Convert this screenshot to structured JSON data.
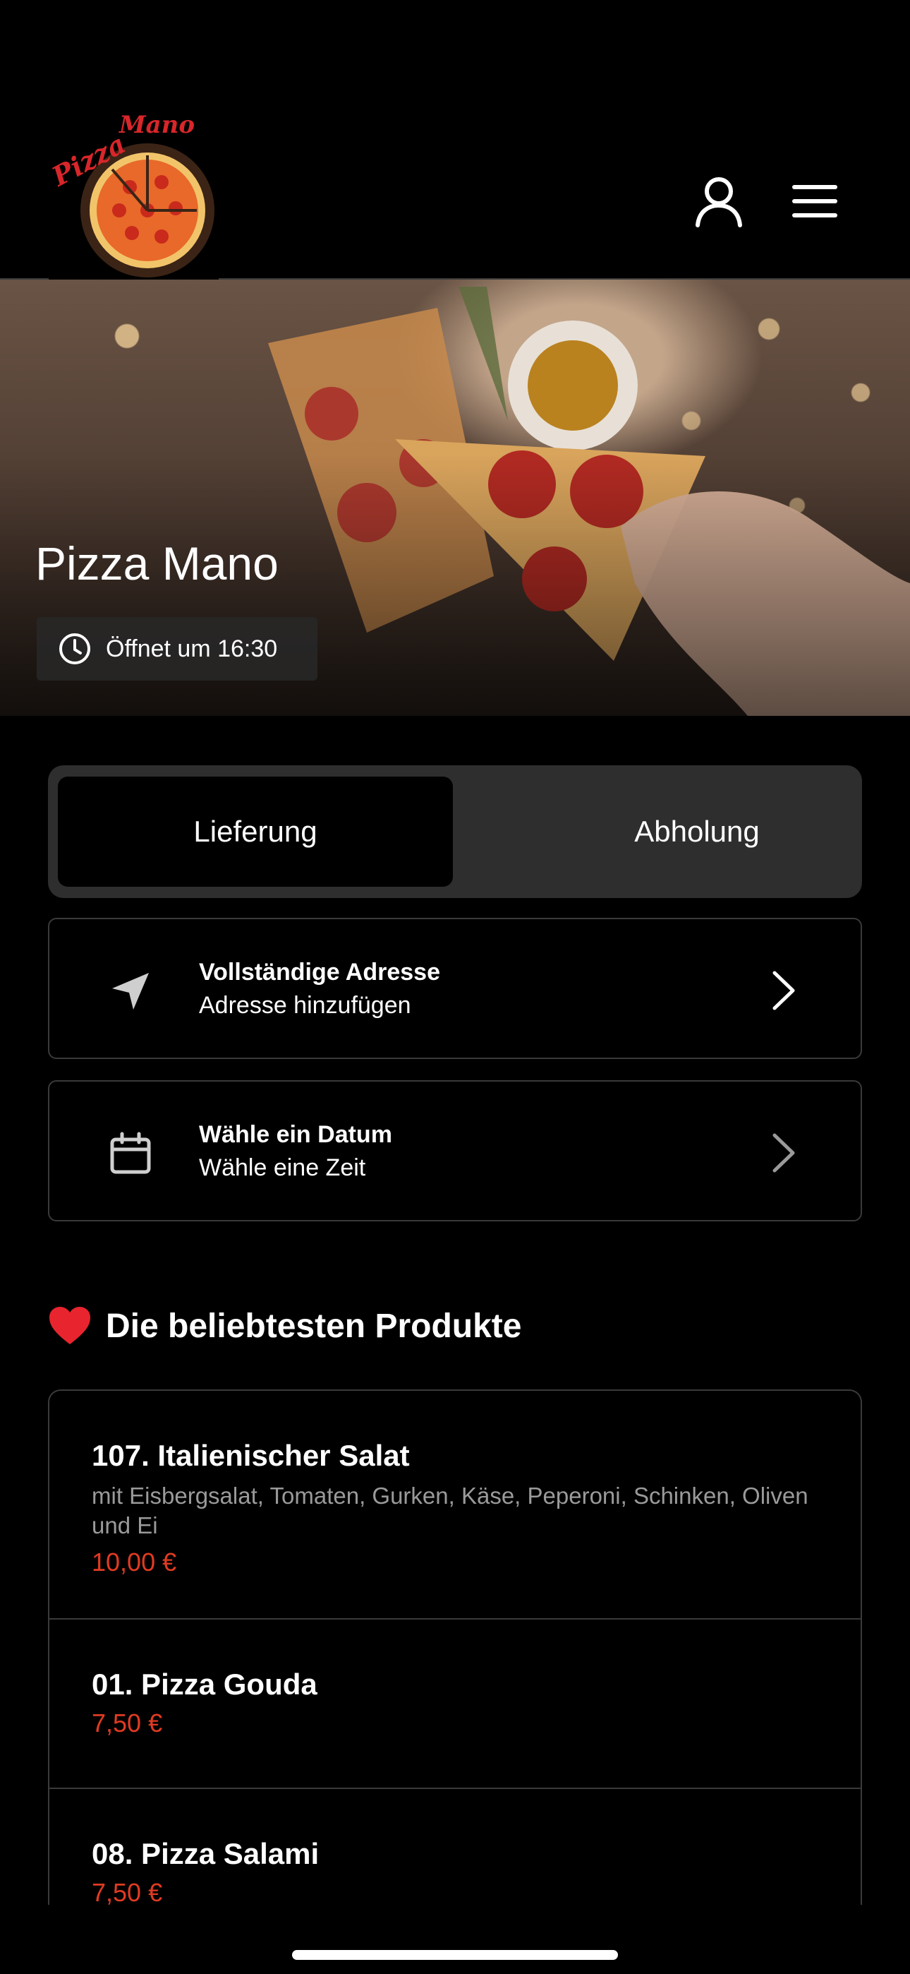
{
  "header": {
    "logo_text": "Pizza Mano",
    "icons": [
      "user-icon",
      "menu-icon"
    ]
  },
  "hero": {
    "title": "Pizza Mano",
    "hours": "Öffnet um 16:30"
  },
  "mode_toggle": {
    "options": [
      "Lieferung",
      "Abholung"
    ],
    "selected": "Lieferung"
  },
  "address_card": {
    "title": "Vollständige Adresse",
    "subtitle": "Adresse hinzufügen"
  },
  "date_card": {
    "title": "Wähle ein Datum",
    "subtitle": "Wähle eine Zeit"
  },
  "popular": {
    "title": "Die beliebtesten Produkte",
    "items": [
      {
        "name": "107. Italienischer Salat",
        "description": "mit Eisbergsalat, Tomaten, Gurken, Käse, Peperoni, Schinken, Oliven und Ei",
        "price": "10,00 €"
      },
      {
        "name": "01. Pizza Gouda",
        "description": "",
        "price": "7,50 €"
      },
      {
        "name": "08. Pizza Salami",
        "description": "",
        "price": "7,50 €"
      }
    ]
  },
  "colors": {
    "background": "#000000",
    "price": "#e03b22",
    "toggle_bg": "#2e2e2e",
    "border": "#3a3a3a"
  }
}
